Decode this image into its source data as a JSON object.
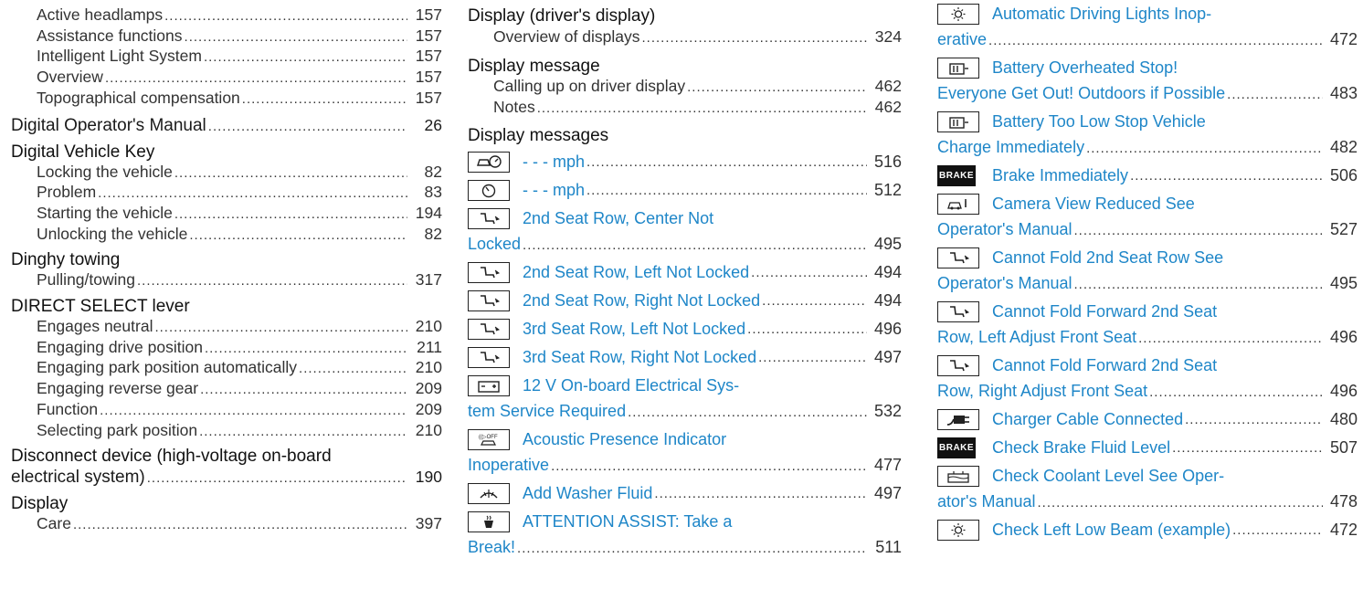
{
  "col1": {
    "rows": [
      {
        "type": "sub",
        "text": "Active headlamps",
        "page": "157"
      },
      {
        "type": "sub",
        "text": "Assistance functions",
        "page": "157"
      },
      {
        "type": "sub",
        "text": "Intelligent Light System",
        "page": "157"
      },
      {
        "type": "sub",
        "text": "Overview",
        "page": "157"
      },
      {
        "type": "sub",
        "text": "Topographical compensation",
        "page": "157"
      },
      {
        "type": "headpage",
        "text": "Digital Operator's Manual",
        "page": "26"
      },
      {
        "type": "head",
        "text": "Digital Vehicle Key"
      },
      {
        "type": "sub",
        "text": "Locking the vehicle",
        "page": "82"
      },
      {
        "type": "sub",
        "text": "Problem",
        "page": "83"
      },
      {
        "type": "sub",
        "text": "Starting the vehicle",
        "page": "194"
      },
      {
        "type": "sub",
        "text": "Unlocking the vehicle",
        "page": "82"
      },
      {
        "type": "head",
        "text": "Dinghy towing"
      },
      {
        "type": "sub",
        "text": "Pulling/towing",
        "page": "317"
      },
      {
        "type": "head",
        "text": "DIRECT SELECT lever"
      },
      {
        "type": "sub",
        "text": "Engages neutral",
        "page": "210"
      },
      {
        "type": "sub",
        "text": "Engaging drive position",
        "page": "211"
      },
      {
        "type": "sub",
        "text": "Engaging park position automatically",
        "page": "210"
      },
      {
        "type": "sub",
        "text": "Engaging reverse gear",
        "page": "209"
      },
      {
        "type": "sub",
        "text": "Function",
        "page": "209"
      },
      {
        "type": "sub",
        "text": "Selecting park position",
        "page": "210"
      },
      {
        "type": "head",
        "text": "Disconnect device (high-voltage on-board"
      },
      {
        "type": "headpage",
        "text": "electrical system)",
        "page": "190"
      },
      {
        "type": "head",
        "text": "Display"
      },
      {
        "type": "sub",
        "text": "Care",
        "page": "397"
      }
    ]
  },
  "col2": {
    "head1": "Display (driver's display)",
    "sub1": {
      "text": "Overview of displays",
      "page": "324"
    },
    "head2": "Display message",
    "sub2a": {
      "text": "Calling up on driver display",
      "page": "462"
    },
    "sub2b": {
      "text": "Notes",
      "page": "462"
    },
    "head3": "Display messages",
    "messages": [
      {
        "icon": "speedo-car-icon",
        "line1": "- - - mph",
        "page": "516"
      },
      {
        "icon": "speedometer-icon",
        "line1": "- - - mph",
        "page": "512"
      },
      {
        "icon": "seat-icon",
        "line1": "2nd Seat Row, Center Not",
        "line2": "Locked",
        "page": "495"
      },
      {
        "icon": "seat-icon",
        "line1": "2nd Seat Row, Left Not Locked",
        "page": "494"
      },
      {
        "icon": "seat-icon",
        "line1": "2nd Seat Row, Right Not Locked",
        "page": "494"
      },
      {
        "icon": "seat-icon",
        "line1": "3rd Seat Row, Left Not Locked",
        "page": "496"
      },
      {
        "icon": "seat-icon",
        "line1": "3rd Seat Row, Right Not Locked",
        "page": "497"
      },
      {
        "icon": "battery-icon",
        "line1": "12 V On-board Electrical Sys-",
        "line2": "tem Service Required",
        "page": "532"
      },
      {
        "icon": "acoustic-off-icon",
        "line1": "Acoustic Presence Indicator",
        "line2": "Inoperative",
        "page": "477"
      },
      {
        "icon": "washer-fluid-icon",
        "line1": "Add Washer Fluid",
        "page": "497"
      },
      {
        "icon": "coffee-cup-icon",
        "line1": "ATTENTION ASSIST: Take a",
        "line2": "Break!",
        "page": "511"
      }
    ]
  },
  "col3": {
    "brake_label": "BRAKE",
    "messages": [
      {
        "icon": "light-sun-icon",
        "line1": "Automatic Driving Lights Inop-",
        "line2": "erative",
        "page": "472"
      },
      {
        "icon": "battery-heat-icon",
        "line1": "Battery Overheated Stop!",
        "line2": "Everyone Get Out! Outdoors if Possible",
        "page": "483"
      },
      {
        "icon": "battery-heat-icon",
        "line1": "Battery Too Low Stop Vehicle",
        "line2": "Charge Immediately",
        "page": "482"
      },
      {
        "icon": "brake-icon",
        "line1": "Brake Immediately",
        "page": "506"
      },
      {
        "icon": "camera-car-icon",
        "line1": "Camera View Reduced See",
        "line2": "Operator's Manual",
        "page": "527"
      },
      {
        "icon": "seat-icon",
        "line1": "Cannot Fold 2nd Seat Row See",
        "line2": "Operator's Manual",
        "page": "495"
      },
      {
        "icon": "seat-icon",
        "line1": "Cannot Fold Forward 2nd Seat",
        "line2": "Row, Left Adjust Front Seat",
        "page": "496"
      },
      {
        "icon": "seat-icon",
        "line1": "Cannot Fold Forward 2nd Seat",
        "line2": "Row, Right Adjust Front Seat",
        "page": "496"
      },
      {
        "icon": "charger-plug-icon",
        "line1": "Charger Cable Connected",
        "page": "480"
      },
      {
        "icon": "brake-icon",
        "line1": "Check Brake Fluid Level",
        "page": "507"
      },
      {
        "icon": "coolant-icon",
        "line1": "Check Coolant Level See Oper-",
        "line2": "ator's Manual",
        "page": "478"
      },
      {
        "icon": "light-sun-icon",
        "line1": "Check Left Low Beam (example)",
        "page": "472"
      }
    ]
  },
  "colors": {
    "link": "#1e86c8",
    "text": "#111111"
  }
}
